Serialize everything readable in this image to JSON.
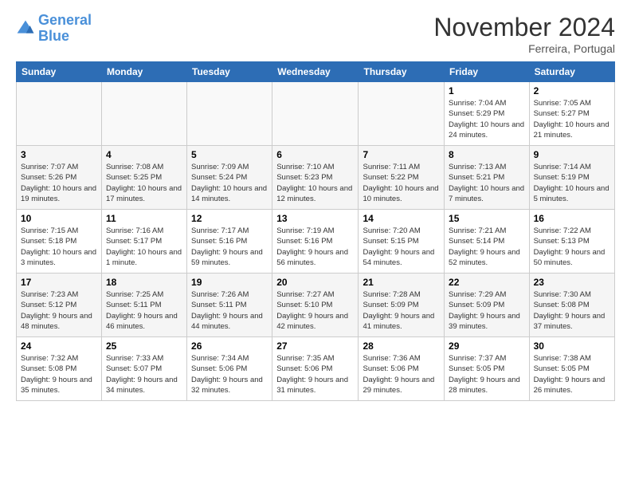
{
  "logo": {
    "line1": "General",
    "line2": "Blue"
  },
  "title": "November 2024",
  "subtitle": "Ferreira, Portugal",
  "days": [
    "Sunday",
    "Monday",
    "Tuesday",
    "Wednesday",
    "Thursday",
    "Friday",
    "Saturday"
  ],
  "weeks": [
    [
      {
        "day": "",
        "info": ""
      },
      {
        "day": "",
        "info": ""
      },
      {
        "day": "",
        "info": ""
      },
      {
        "day": "",
        "info": ""
      },
      {
        "day": "",
        "info": ""
      },
      {
        "day": "1",
        "info": "Sunrise: 7:04 AM\nSunset: 5:29 PM\nDaylight: 10 hours and 24 minutes."
      },
      {
        "day": "2",
        "info": "Sunrise: 7:05 AM\nSunset: 5:27 PM\nDaylight: 10 hours and 21 minutes."
      }
    ],
    [
      {
        "day": "3",
        "info": "Sunrise: 7:07 AM\nSunset: 5:26 PM\nDaylight: 10 hours and 19 minutes."
      },
      {
        "day": "4",
        "info": "Sunrise: 7:08 AM\nSunset: 5:25 PM\nDaylight: 10 hours and 17 minutes."
      },
      {
        "day": "5",
        "info": "Sunrise: 7:09 AM\nSunset: 5:24 PM\nDaylight: 10 hours and 14 minutes."
      },
      {
        "day": "6",
        "info": "Sunrise: 7:10 AM\nSunset: 5:23 PM\nDaylight: 10 hours and 12 minutes."
      },
      {
        "day": "7",
        "info": "Sunrise: 7:11 AM\nSunset: 5:22 PM\nDaylight: 10 hours and 10 minutes."
      },
      {
        "day": "8",
        "info": "Sunrise: 7:13 AM\nSunset: 5:21 PM\nDaylight: 10 hours and 7 minutes."
      },
      {
        "day": "9",
        "info": "Sunrise: 7:14 AM\nSunset: 5:19 PM\nDaylight: 10 hours and 5 minutes."
      }
    ],
    [
      {
        "day": "10",
        "info": "Sunrise: 7:15 AM\nSunset: 5:18 PM\nDaylight: 10 hours and 3 minutes."
      },
      {
        "day": "11",
        "info": "Sunrise: 7:16 AM\nSunset: 5:17 PM\nDaylight: 10 hours and 1 minute."
      },
      {
        "day": "12",
        "info": "Sunrise: 7:17 AM\nSunset: 5:16 PM\nDaylight: 9 hours and 59 minutes."
      },
      {
        "day": "13",
        "info": "Sunrise: 7:19 AM\nSunset: 5:16 PM\nDaylight: 9 hours and 56 minutes."
      },
      {
        "day": "14",
        "info": "Sunrise: 7:20 AM\nSunset: 5:15 PM\nDaylight: 9 hours and 54 minutes."
      },
      {
        "day": "15",
        "info": "Sunrise: 7:21 AM\nSunset: 5:14 PM\nDaylight: 9 hours and 52 minutes."
      },
      {
        "day": "16",
        "info": "Sunrise: 7:22 AM\nSunset: 5:13 PM\nDaylight: 9 hours and 50 minutes."
      }
    ],
    [
      {
        "day": "17",
        "info": "Sunrise: 7:23 AM\nSunset: 5:12 PM\nDaylight: 9 hours and 48 minutes."
      },
      {
        "day": "18",
        "info": "Sunrise: 7:25 AM\nSunset: 5:11 PM\nDaylight: 9 hours and 46 minutes."
      },
      {
        "day": "19",
        "info": "Sunrise: 7:26 AM\nSunset: 5:11 PM\nDaylight: 9 hours and 44 minutes."
      },
      {
        "day": "20",
        "info": "Sunrise: 7:27 AM\nSunset: 5:10 PM\nDaylight: 9 hours and 42 minutes."
      },
      {
        "day": "21",
        "info": "Sunrise: 7:28 AM\nSunset: 5:09 PM\nDaylight: 9 hours and 41 minutes."
      },
      {
        "day": "22",
        "info": "Sunrise: 7:29 AM\nSunset: 5:09 PM\nDaylight: 9 hours and 39 minutes."
      },
      {
        "day": "23",
        "info": "Sunrise: 7:30 AM\nSunset: 5:08 PM\nDaylight: 9 hours and 37 minutes."
      }
    ],
    [
      {
        "day": "24",
        "info": "Sunrise: 7:32 AM\nSunset: 5:08 PM\nDaylight: 9 hours and 35 minutes."
      },
      {
        "day": "25",
        "info": "Sunrise: 7:33 AM\nSunset: 5:07 PM\nDaylight: 9 hours and 34 minutes."
      },
      {
        "day": "26",
        "info": "Sunrise: 7:34 AM\nSunset: 5:06 PM\nDaylight: 9 hours and 32 minutes."
      },
      {
        "day": "27",
        "info": "Sunrise: 7:35 AM\nSunset: 5:06 PM\nDaylight: 9 hours and 31 minutes."
      },
      {
        "day": "28",
        "info": "Sunrise: 7:36 AM\nSunset: 5:06 PM\nDaylight: 9 hours and 29 minutes."
      },
      {
        "day": "29",
        "info": "Sunrise: 7:37 AM\nSunset: 5:05 PM\nDaylight: 9 hours and 28 minutes."
      },
      {
        "day": "30",
        "info": "Sunrise: 7:38 AM\nSunset: 5:05 PM\nDaylight: 9 hours and 26 minutes."
      }
    ]
  ]
}
